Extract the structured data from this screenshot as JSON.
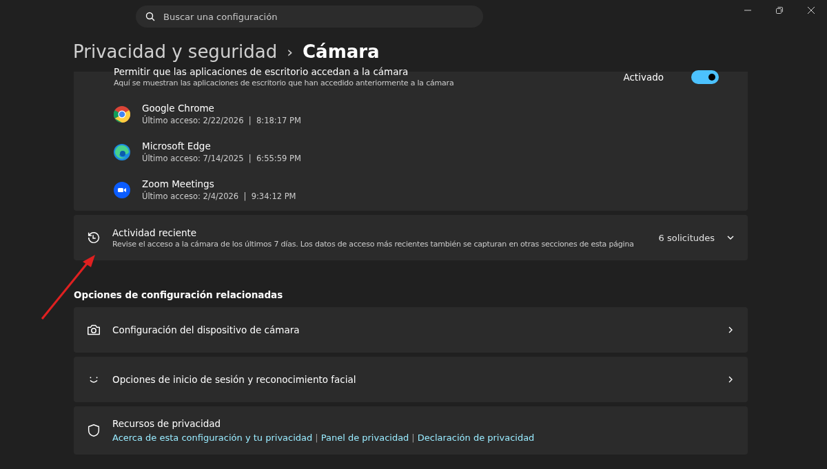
{
  "search": {
    "placeholder": "Buscar una configuración"
  },
  "breadcrumb": {
    "parent": "Privacidad y seguridad",
    "separator": "›",
    "current": "Cámara"
  },
  "desktop_apps": {
    "title": "Permitir que las aplicaciones de escritorio accedan a la cámara",
    "description": "Aquí se muestran las aplicaciones de escritorio que han accedido anteriormente a la cámara",
    "toggle_label": "Activado",
    "on": true,
    "apps": [
      {
        "name": "Google Chrome",
        "access": "Último acceso: 2/22/2026  |  8:18:17 PM",
        "kind": "chrome"
      },
      {
        "name": "Microsoft Edge",
        "access": "Último acceso: 7/14/2025  |  6:55:59 PM",
        "kind": "edge"
      },
      {
        "name": "Zoom Meetings",
        "access": "Último acceso: 2/4/2026  |  9:34:12 PM",
        "kind": "zoom"
      }
    ]
  },
  "recent_activity": {
    "title": "Actividad reciente",
    "description": "Revise el acceso a la cámara de los últimos 7 días. Los datos de acceso más recientes también se capturan en otras secciones de esta página",
    "count": "6 solicitudes",
    "expanded": false
  },
  "related": {
    "heading": "Opciones de configuración relacionadas",
    "items": [
      {
        "kind": "camera",
        "label": "Configuración del dispositivo de cámara"
      },
      {
        "kind": "face",
        "label": "Opciones de inicio de sesión y reconocimiento facial"
      },
      {
        "kind": "shield",
        "label": "Recursos de privacidad",
        "links": [
          "Acerca de esta configuración y tu privacidad",
          "Panel de privacidad",
          "Declaración de privacidad"
        ],
        "link_separators": [
          "|",
          "|"
        ]
      }
    ]
  }
}
